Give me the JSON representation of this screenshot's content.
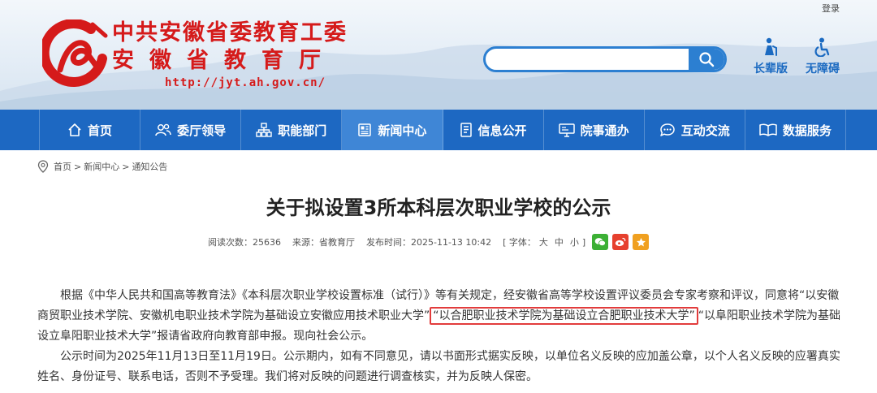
{
  "header": {
    "login_label": "登录",
    "title_line1": "中共安徽省委教育工委",
    "title_line2": "安徽省教育厅",
    "url": "http://jyt.ah.gov.cn/",
    "search_placeholder": "",
    "tools": [
      {
        "label": "长辈版",
        "icon": "elder-icon"
      },
      {
        "label": "无障碍",
        "icon": "accessibility-icon"
      }
    ]
  },
  "nav": {
    "items": [
      {
        "label": "首页",
        "icon": "home-icon"
      },
      {
        "label": "委厅领导",
        "icon": "people-icon"
      },
      {
        "label": "职能部门",
        "icon": "org-chart-icon"
      },
      {
        "label": "新闻中心",
        "icon": "news-icon"
      },
      {
        "label": "信息公开",
        "icon": "document-icon"
      },
      {
        "label": "院事通办",
        "icon": "monitor-icon"
      },
      {
        "label": "互动交流",
        "icon": "chat-icon"
      },
      {
        "label": "数据服务",
        "icon": "book-icon"
      }
    ],
    "active_index": 3
  },
  "breadcrumb": {
    "items": [
      "首页",
      "新闻中心",
      "通知公告"
    ],
    "separator": ">"
  },
  "article": {
    "title": "关于拟设置3所本科层次职业学校的公示",
    "views_label": "阅读次数：",
    "views": "25636",
    "source_label": "来源：",
    "source": "省教育厅",
    "date_label": "发布时间：",
    "date": "2025-11-13 10:42",
    "font_label": "[ 字体：",
    "font_large": "大",
    "font_medium": "中",
    "font_small": "小",
    "font_close": "]",
    "para1_before": "根据《中华人民共和国高等教育法》《本科层次职业学校设置标准（试行）》等有关规定，经安徽省高等学校设置评议委员会专家考察和评议，同意将“以安徽商贸职业技术学院、安徽机电职业技术学院为基础设立安徽应用技术职业大学”",
    "para1_highlight": "“以合肥职业技术学院为基础设立合肥职业技术大学”",
    "para1_after": "“以阜阳职业技术学院为基础设立阜阳职业技术大学”报请省政府向教育部申报。现向社会公示。",
    "para2": "公示时间为2025年11月13日至11月19日。公示期内，如有不同意见，请以书面形式据实反映，以单位名义反映的应加盖公章，以个人名义反映的应署真实姓名、身份证号、联系电话，否则不予受理。我们将对反映的问题进行调查核实，并为反映人保密。"
  },
  "colors": {
    "brand_red": "#d51a1a",
    "nav_blue": "#1d68c2",
    "nav_active": "#3f86d6",
    "highlight_border": "#e23c3c",
    "wechat": "#3cb035",
    "weibo": "#e6402e",
    "favorite": "#f0a020"
  }
}
